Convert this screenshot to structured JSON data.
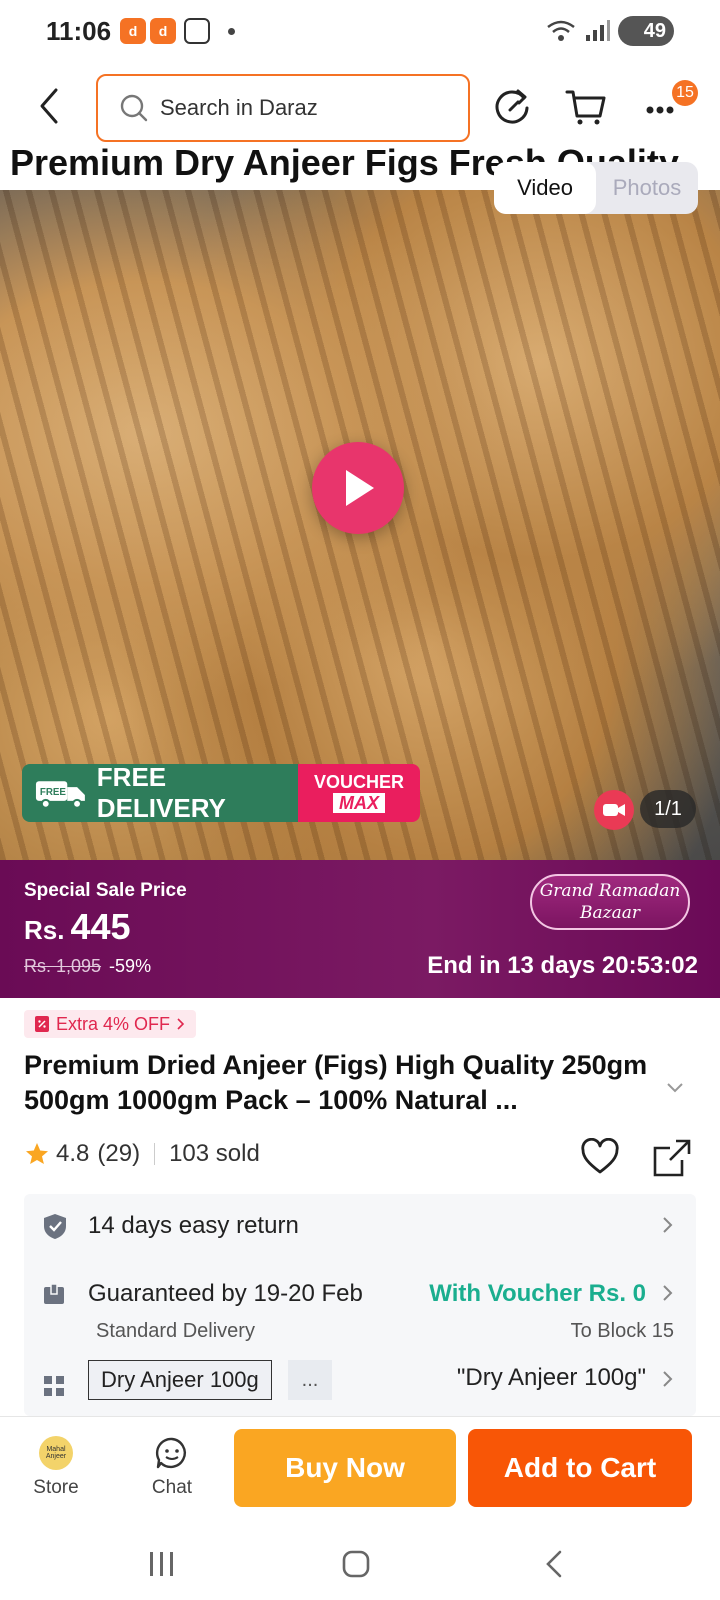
{
  "status_bar": {
    "time": "11:06",
    "battery": "49",
    "app_badge": "d"
  },
  "search": {
    "placeholder": "Search in Daraz"
  },
  "nav": {
    "more_badge": "15"
  },
  "hero": {
    "title": "Premium Dry Anjeer Figs Fresh Quality",
    "tabs": [
      "Video",
      "Photos"
    ],
    "active_tab": "Video",
    "free_badge": "FREE",
    "promo_free": "FREE DELIVERY",
    "promo_voucher_top": "VOUCHER",
    "promo_voucher_bottom": "MAX",
    "counter": "1/1"
  },
  "price_banner": {
    "label": "Special Sale Price",
    "currency": "Rs.",
    "price": "445",
    "original_price": "Rs. 1,095",
    "discount": "-59%",
    "event_line1": "Grand Ramadan",
    "event_line2": "Bazaar",
    "countdown": "End in 13 days 20:53:02"
  },
  "product": {
    "extra_off": "Extra 4% OFF",
    "title": "Premium Dried Anjeer (Figs) High Quality 250gm 500gm 1000gm Pack – 100% Natural ...",
    "rating": "4.8",
    "reviews": "(29)",
    "sold": "103 sold"
  },
  "info": {
    "return_policy": "14 days easy return",
    "delivery_guarantee": "Guaranteed by 19-20 Feb",
    "delivery_voucher": "With Voucher Rs. 0",
    "delivery_type": "Standard Delivery",
    "delivery_location": "To Block 15",
    "variant_selected": "Dry Anjeer 100g",
    "variant_more": "...",
    "variant_label": "\"Dry Anjeer 100g\""
  },
  "actions": {
    "store": "Store",
    "store_logo_text": "Mahal Anjeer",
    "chat": "Chat",
    "buy_now": "Buy Now",
    "add_to_cart": "Add to Cart"
  },
  "colors": {
    "brand_orange": "#f57224",
    "buy_now": "#faa622",
    "add_to_cart": "#f85606",
    "price_banner": "#6a0b55",
    "voucher_green": "#1aae8f"
  }
}
